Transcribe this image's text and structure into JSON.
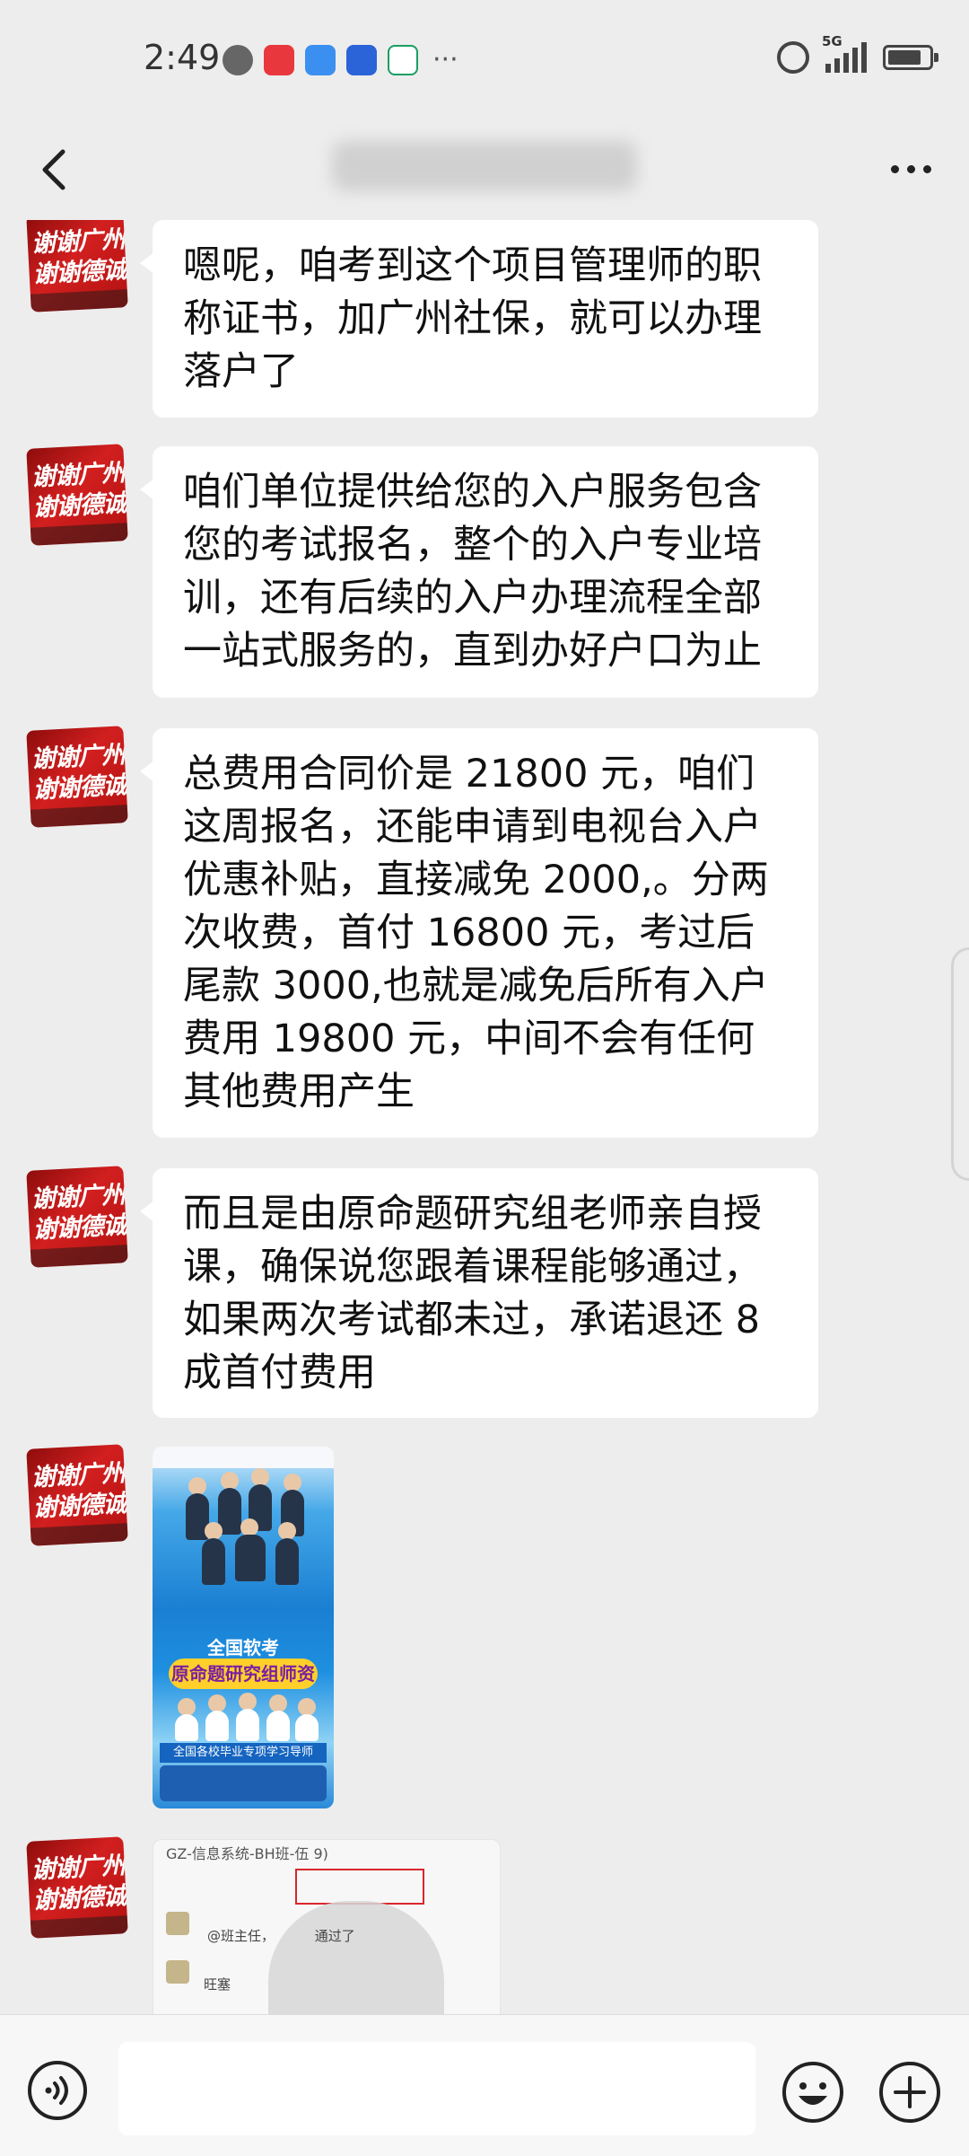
{
  "status_bar": {
    "time": "2:49",
    "network": "5G",
    "notification_icons": [
      "message-icon",
      "reader-icon",
      "cloud-icon",
      "app-icon",
      "bank-icon"
    ],
    "overflow": "···"
  },
  "header": {
    "back_icon": "chevron-left-icon",
    "contact_name_blurred": true,
    "more_icon": "more-icon"
  },
  "messages": [
    {
      "type": "text",
      "text": "嗯呢，咱考到这个项目管理师的职称证书，加广州社保，就可以办理落户了"
    },
    {
      "type": "text",
      "text": "咱们单位提供给您的入户服务包含您的考试报名，整个的入户专业培训，还有后续的入户办理流程全部一站式服务的，直到办好户口为止"
    },
    {
      "type": "text",
      "text": "总费用合同价是 21800 元，咱们这周报名，还能申请到电视台入户优惠补贴，直接减免 2000,。分两次收费，首付 16800 元，考过后尾款 3000,也就是减免后所有入户费用 19800 元，中间不会有任何其他费用产生"
    },
    {
      "type": "text",
      "text": "而且是由原命题研究组老师亲自授课，确保说您跟着课程能够通过，如果两次考试都未过，承诺退还 8 成首付费用"
    },
    {
      "type": "image",
      "banner_title": "全国软考",
      "banner_subtitle": "原命题研究组师资",
      "banner_footer": "全国各校毕业专项学习导师"
    },
    {
      "type": "image",
      "caption": "GZ-信息系统-BH班-伍    9)",
      "mention": "@班主任，",
      "passed": "通过了",
      "reply": "旺塞"
    }
  ],
  "avatar_text": [
    "谢谢广州",
    "谢谢德诚"
  ],
  "input_bar": {
    "voice_icon": "voice-icon",
    "input_value": "",
    "emoji_icon": "emoji-icon",
    "plus_icon": "plus-icon"
  }
}
